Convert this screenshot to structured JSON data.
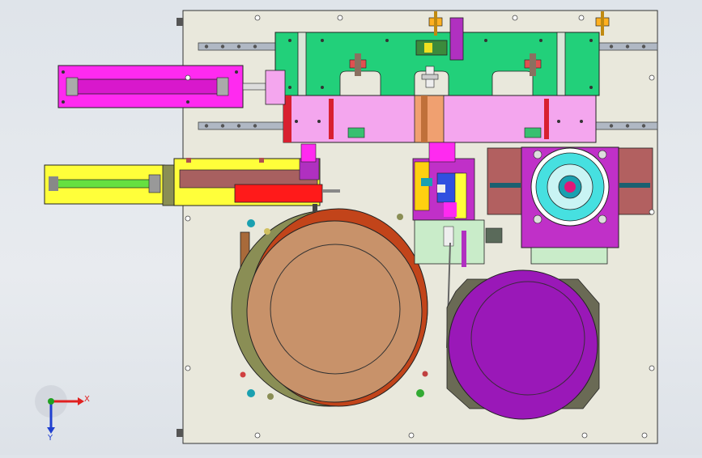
{
  "triad": {
    "x_label": "X",
    "y_label": "Y",
    "x_color": "#e02020",
    "y_color": "#2040d0",
    "z_color": "#20a020"
  },
  "colors": {
    "base_plate": "#e9e8dc",
    "guide_rail": "#b0b8c4",
    "top_frame": "#22d07a",
    "pink_block": "#f4a6ee",
    "magenta_cylinder": "#ff2af0",
    "yellow_block": "#ffff3a",
    "red_slide": "#ff1a1a",
    "green_rod": "#66e040",
    "orange_disc": "#c2441a",
    "tan_disc": "#c8926a",
    "olive_ring": "#8a8e55",
    "purple_disc": "#9a18b8",
    "purple_ring": "#6a6a55",
    "rotary_frame": "#c030c8",
    "rotary_bore": "#46e0e0",
    "brown_plate": "#b26060",
    "light_green": "#c9ecc9"
  }
}
